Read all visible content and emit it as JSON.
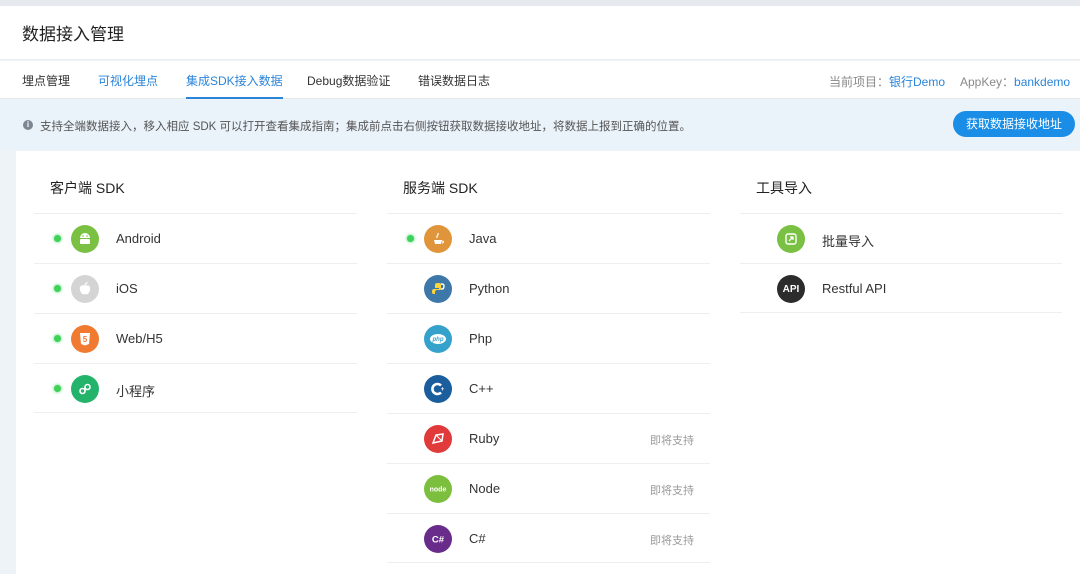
{
  "header": {
    "title": "数据接入管理"
  },
  "tabs": [
    {
      "label": "埋点管理"
    },
    {
      "label": "可视化埋点"
    },
    {
      "label": "集成SDK接入数据"
    },
    {
      "label": "Debug数据验证"
    },
    {
      "label": "错误数据日志"
    }
  ],
  "project": {
    "label": "当前项目：",
    "value": "银行Demo",
    "appkey_label": "AppKey：",
    "appkey_value": "bankdemo"
  },
  "notice": {
    "text": "支持全端数据接入，移入相应 SDK 可以打开查看集成指南；集成前点击右侧按钮获取数据接收地址，将数据上报到正确的位置。",
    "button": "获取数据接收地址"
  },
  "client": {
    "title": "客户端 SDK",
    "items": [
      {
        "name": "Android",
        "icon": "android-icon",
        "color": "#7ac143"
      },
      {
        "name": "iOS",
        "icon": "apple-icon",
        "color": "#d4d4d4"
      },
      {
        "name": "Web/H5",
        "icon": "html5-icon",
        "color": "#ef7a30"
      },
      {
        "name": "小程序",
        "icon": "mini-program-icon",
        "color": "#24b36b"
      }
    ]
  },
  "server": {
    "title": "服务端 SDK",
    "items": [
      {
        "name": "Java",
        "icon": "java-icon",
        "color": "#e0953a",
        "soon": ""
      },
      {
        "name": "Python",
        "icon": "python-icon",
        "color": "#3d78a8",
        "soon": ""
      },
      {
        "name": "Php",
        "icon": "php-icon",
        "color": "#36a2cc",
        "soon": ""
      },
      {
        "name": "C++",
        "icon": "cpp-icon",
        "color": "#1b5e9e",
        "soon": ""
      },
      {
        "name": "Ruby",
        "icon": "ruby-icon",
        "color": "#e03a3a",
        "soon": "即将支持"
      },
      {
        "name": "Node",
        "icon": "node-icon",
        "color": "#7cbf3f",
        "soon": "即将支持"
      },
      {
        "name": "C#",
        "icon": "csharp-icon",
        "color": "#6a2c8a",
        "soon": "即将支持"
      }
    ]
  },
  "tools": {
    "title": "工具导入",
    "items": [
      {
        "name": "批量导入",
        "icon": "batch-import-icon",
        "color": "#7ac143"
      },
      {
        "name": "Restful API",
        "icon": "api-icon",
        "color": "#2c2c2c",
        "label": "API"
      }
    ]
  }
}
